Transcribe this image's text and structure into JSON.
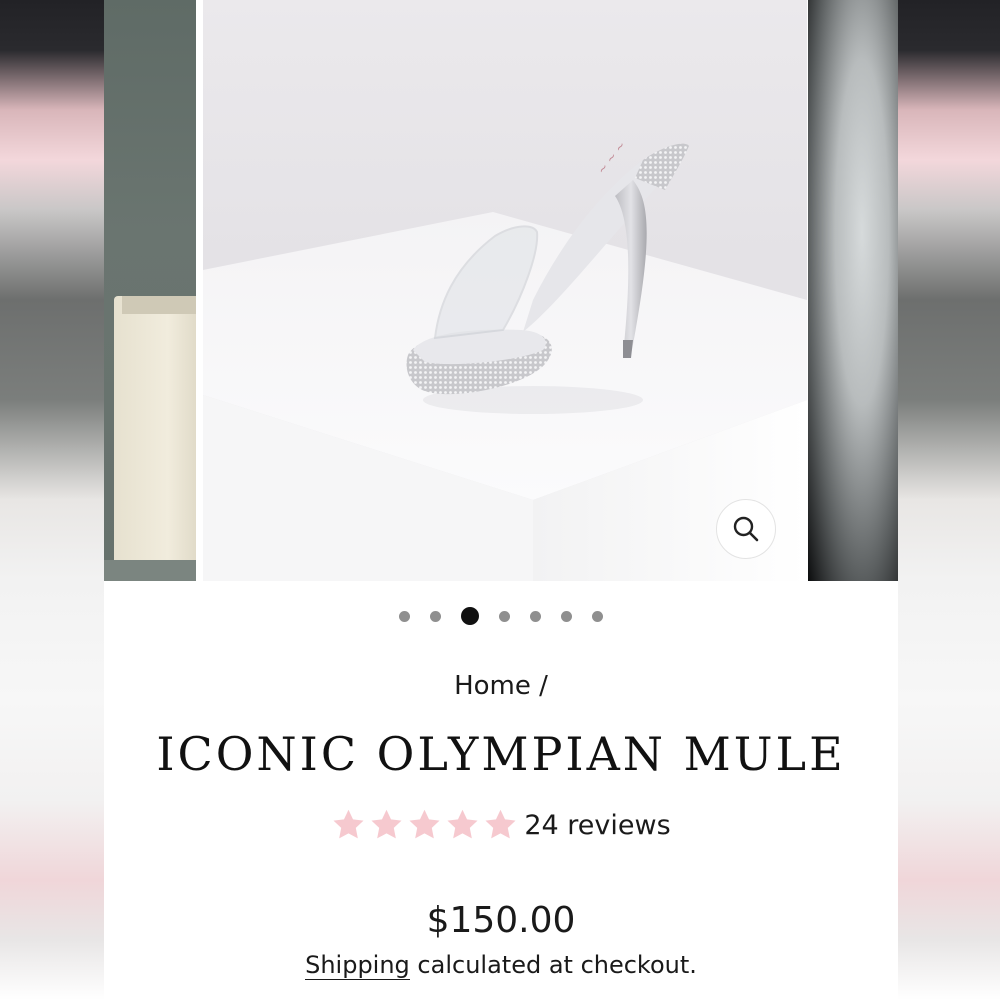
{
  "gallery": {
    "zoom_icon": "magnifier-icon",
    "dots_count": 7,
    "active_dot_index": 2
  },
  "breadcrumb": {
    "home_label": "Home",
    "separator": "/"
  },
  "product": {
    "title": "ICONIC OLYMPIAN MULE",
    "rating": 5,
    "rating_max": 5,
    "reviews_label": "24 reviews",
    "price": "$150.00",
    "shipping_link": "Shipping",
    "shipping_rest": " calculated at checkout."
  },
  "colors": {
    "star": "#f6c9cf",
    "text": "#1a1a1a",
    "active_dot": "#111111",
    "inactive_dot": "#8f8f8f"
  }
}
